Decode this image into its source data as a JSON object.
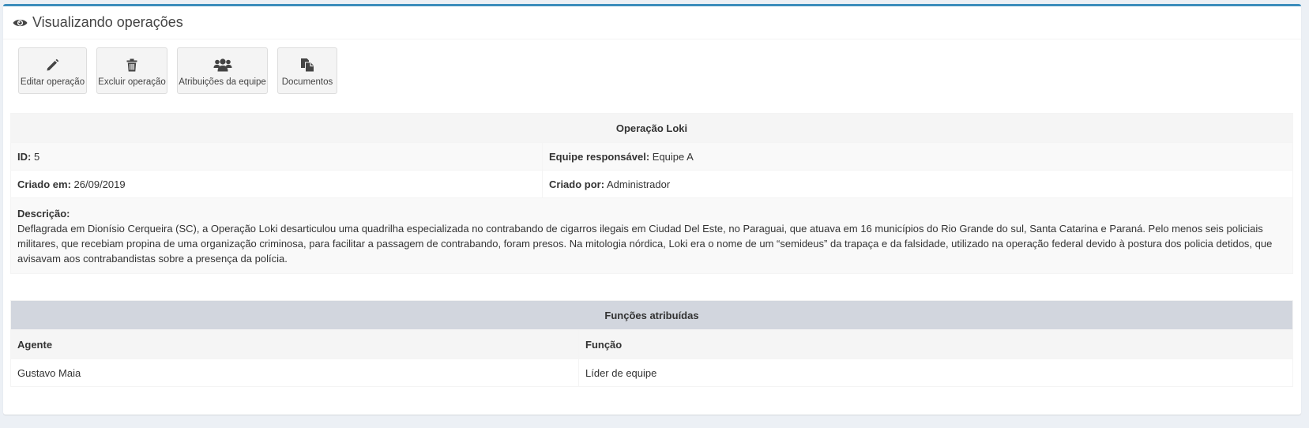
{
  "header": {
    "icon": "eye-icon",
    "title": "Visualizando operações"
  },
  "toolbar": [
    {
      "icon": "pencil-icon",
      "label": "Editar operação"
    },
    {
      "icon": "trash-icon",
      "label": "Excluir operação"
    },
    {
      "icon": "users-icon",
      "label": "Atribuições da equipe"
    },
    {
      "icon": "documents-icon",
      "label": "Documentos"
    }
  ],
  "operation": {
    "title": "Operação Loki",
    "id_label": "ID:",
    "id_value": "5",
    "team_label": "Equipe responsável:",
    "team_value": "Equipe A",
    "created_at_label": "Criado em:",
    "created_at_value": "26/09/2019",
    "created_by_label": "Criado por:",
    "created_by_value": "Administrador",
    "description_label": "Descrição:",
    "description_value": "Deflagrada em Dionísio Cerqueira (SC), a Operação Loki desarticulou uma quadrilha especializada no contrabando de cigarros ilegais em Ciudad Del Este, no Paraguai, que atuava em 16 municípios do Rio Grande do sul, Santa Catarina e Paraná. Pelo menos seis policiais militares, que recebiam propina de uma organização criminosa, para facilitar a passagem de contrabando, foram presos. Na mitologia nórdica, Loki era o nome de um “semideus” da trapaça e da falsidade, utilizado na operação federal devido à postura dos policia detidos, que avisavam aos contrabandistas sobre a presença da polícia."
  },
  "assignments": {
    "title": "Funções atribuídas",
    "columns": [
      "Agente",
      "Função"
    ],
    "rows": [
      [
        "Gustavo Maia",
        "Líder de equipe"
      ]
    ]
  },
  "colors": {
    "accent": "#3c8dbc",
    "background": "#ecf0f5",
    "table_header": "#d2d6de"
  }
}
